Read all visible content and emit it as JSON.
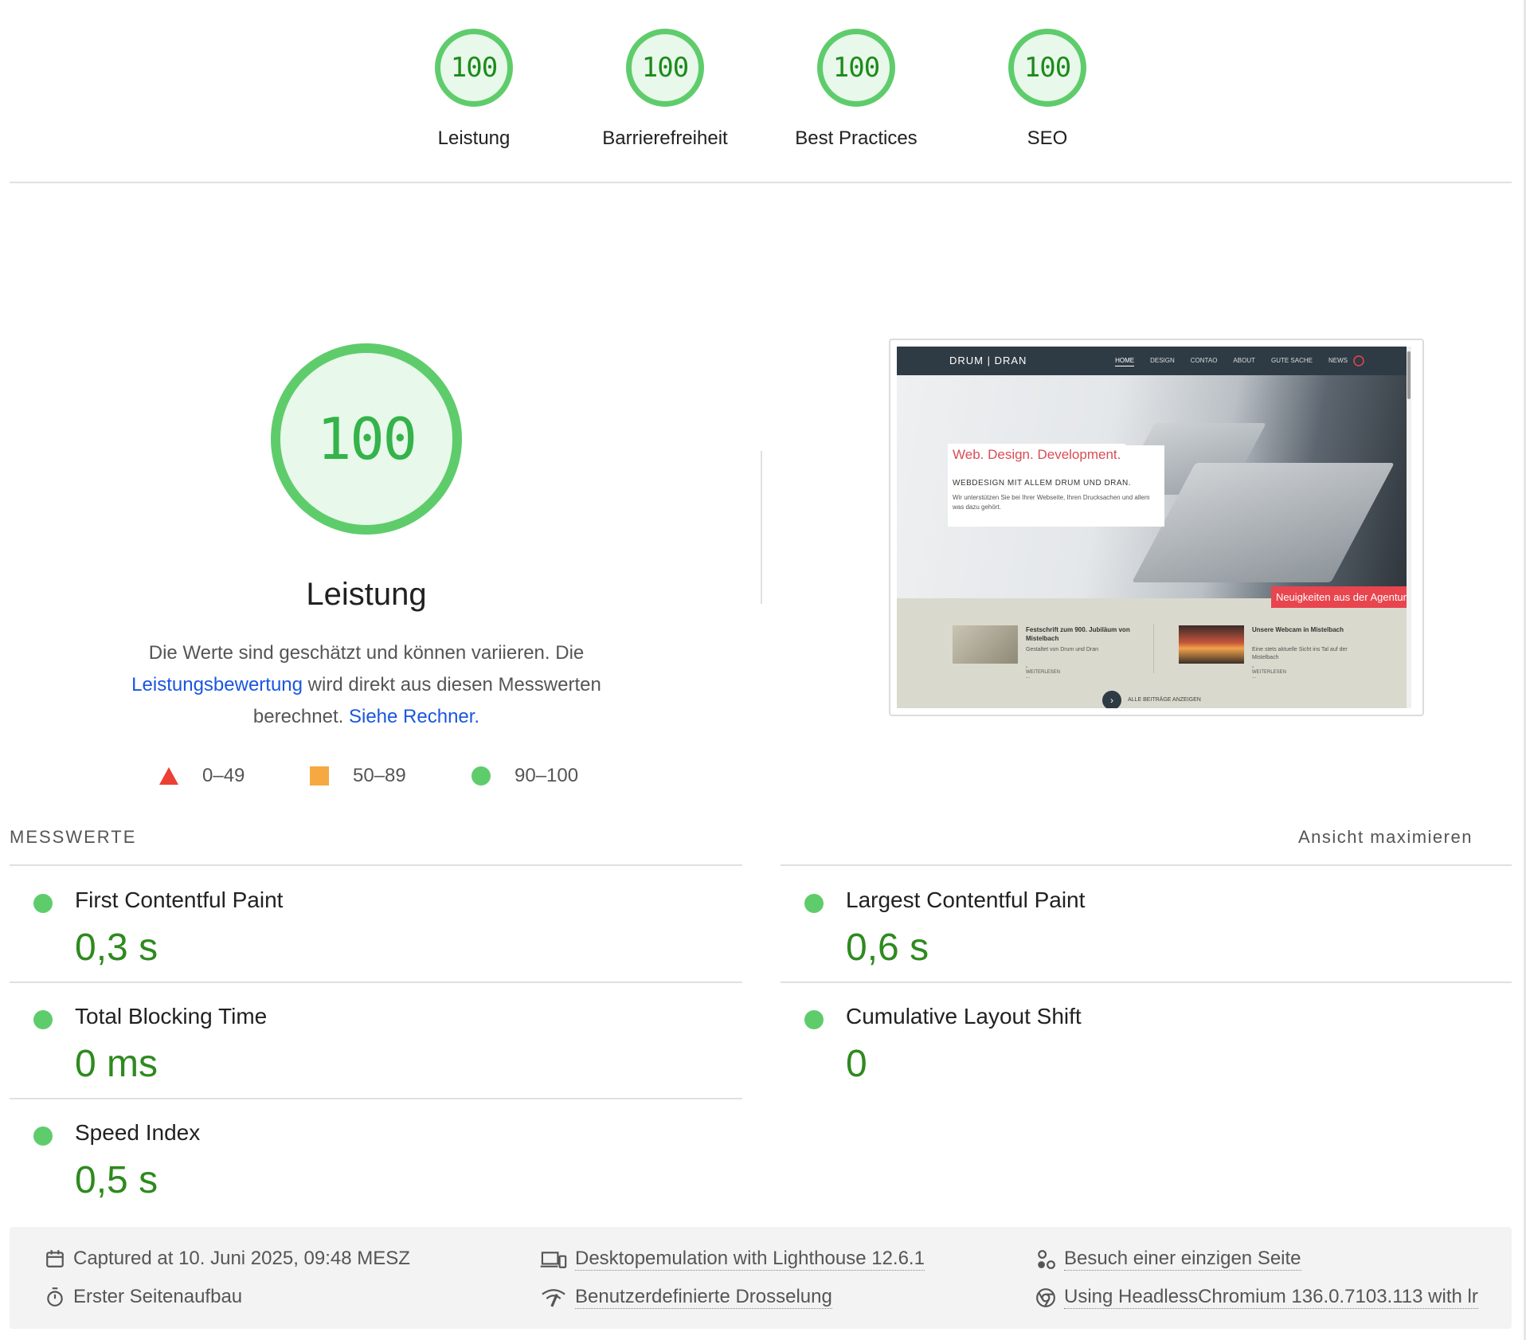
{
  "categories": [
    {
      "score": "100",
      "label": "Leistung"
    },
    {
      "score": "100",
      "label": "Barrierefreiheit"
    },
    {
      "score": "100",
      "label": "Best Practices"
    },
    {
      "score": "100",
      "label": "SEO"
    }
  ],
  "performance": {
    "score": "100",
    "title": "Leistung",
    "desc_1": "Die Werte sind geschätzt und können variieren. Die",
    "link_1": "Leistungsbewertung",
    "desc_2": "wird direkt aus diesen Messwerten",
    "desc_3": "berechnet.",
    "link_2": "Siehe Rechner."
  },
  "legend": {
    "fail": "0–49",
    "average": "50–89",
    "pass": "90–100"
  },
  "colors": {
    "pass": "#5fcc6c",
    "average": "#f5a940",
    "fail": "#eb4034",
    "value_green": "#2e8a1e",
    "link": "#1a56e0"
  },
  "site_preview": {
    "logo": "DRUM | DRAN",
    "menu": [
      "HOME",
      "DESIGN",
      "CONTAO",
      "ABOUT",
      "GUTE SACHE",
      "NEWS"
    ],
    "hero_title": "Web. Design. Development.",
    "hero_subtitle": "WEBDESIGN MIT ALLEM DRUM UND DRAN.",
    "hero_text": "Wir unterstützen Sie bei Ihrer Webseite, Ihren Druck­sachen und allem was dazu gehört.",
    "news_tag": "Neuigkeiten aus der Agentur",
    "posts": [
      {
        "title": "Festschrift zum 900. Jubiläum von Mistelbach",
        "sub": "Gestaltet von Drum und Dran",
        "more": "› WEITERLESEN ..."
      },
      {
        "title": "Unsere Webcam in Mistelbach",
        "sub": "Eine stets aktuelle Sicht ins Tal auf der Mistelbach",
        "more": "› WEITERLESEN ..."
      }
    ],
    "all_posts": "ALLE BEITRÄGE ANZEIGEN"
  },
  "metrics": {
    "heading": "MESSWERTE",
    "expand_label": "Ansicht maximieren",
    "items": [
      {
        "name": "First Contentful Paint",
        "value": "0,3 s"
      },
      {
        "name": "Largest Contentful Paint",
        "value": "0,6 s"
      },
      {
        "name": "Total Blocking Time",
        "value": "0 ms"
      },
      {
        "name": "Cumulative Layout Shift",
        "value": "0"
      },
      {
        "name": "Speed Index",
        "value": "0,5 s"
      }
    ]
  },
  "footer": {
    "captured": "Captured at 10. Juni 2025, 09:48 MESZ",
    "emulation": "Desktopemulation with Lighthouse 12.6.1",
    "session": "Besuch einer einzigen Seite",
    "load": "Erster Seitenaufbau",
    "throttling": "Benutzerdefinierte Drosselung",
    "browser": "Using HeadlessChromium 136.0.7103.113 with lr",
    "icons": [
      "calendar-icon",
      "devices-icon",
      "user-flow-icon",
      "stopwatch-icon",
      "network-icon",
      "chrome-icon"
    ]
  }
}
